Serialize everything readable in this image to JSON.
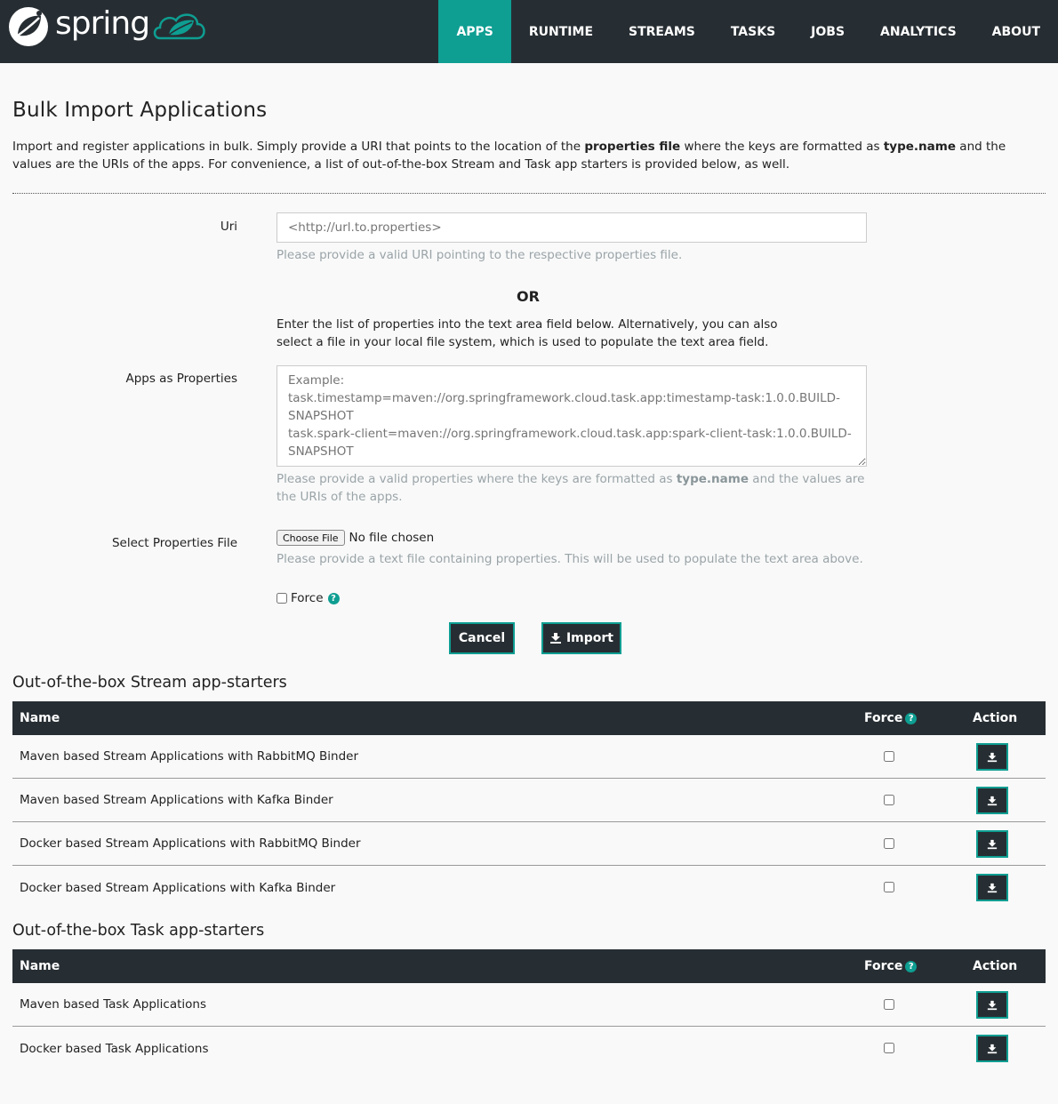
{
  "brand": {
    "name": "spring"
  },
  "nav": {
    "items": [
      {
        "label": "APPS",
        "active": true
      },
      {
        "label": "RUNTIME",
        "active": false
      },
      {
        "label": "STREAMS",
        "active": false
      },
      {
        "label": "TASKS",
        "active": false
      },
      {
        "label": "JOBS",
        "active": false
      },
      {
        "label": "ANALYTICS",
        "active": false
      },
      {
        "label": "ABOUT",
        "active": false
      }
    ]
  },
  "page": {
    "title": "Bulk Import Applications",
    "intro_1": "Import and register applications in bulk. Simply provide a URI that points to the location of the ",
    "intro_bold_1": "properties file",
    "intro_2": " where the keys are formatted as ",
    "intro_bold_2": "type.name",
    "intro_3": " and the values are the URIs of the apps. For convenience, a list of out-of-the-box Stream and Task app starters is provided below, as well."
  },
  "form": {
    "uri_label": "Uri",
    "uri_placeholder": "<http://url.to.properties>",
    "uri_help": "Please provide a valid URI pointing to the respective properties file.",
    "or_label": "OR",
    "or_text": "Enter the list of properties into the text area field below. Alternatively, you can also select a file in your local file system, which is used to populate the text area field.",
    "props_label": "Apps as Properties",
    "props_placeholder": "Example:\ntask.timestamp=maven://org.springframework.cloud.task.app:timestamp-task:1.0.0.BUILD-SNAPSHOT\ntask.spark-client=maven://org.springframework.cloud.task.app:spark-client-task:1.0.0.BUILD-SNAPSHOT",
    "props_help_1": "Please provide a valid properties where the keys are formatted as ",
    "props_help_bold": "type.name",
    "props_help_2": " and the values are the URIs of the apps.",
    "file_label": "Select Properties File",
    "choose_file": "Choose File",
    "file_status": "No file chosen",
    "file_help": "Please provide a text file containing properties. This will be used to populate the text area above.",
    "force_label": "Force",
    "cancel_label": "Cancel",
    "import_label": "Import"
  },
  "stream_starters": {
    "title": "Out-of-the-box Stream app-starters",
    "col_name": "Name",
    "col_force": "Force",
    "col_action": "Action",
    "rows": [
      {
        "name": "Maven based Stream Applications with RabbitMQ Binder"
      },
      {
        "name": "Maven based Stream Applications with Kafka Binder"
      },
      {
        "name": "Docker based Stream Applications with RabbitMQ Binder"
      },
      {
        "name": "Docker based Stream Applications with Kafka Binder"
      }
    ]
  },
  "task_starters": {
    "title": "Out-of-the-box Task app-starters",
    "col_name": "Name",
    "col_force": "Force",
    "col_action": "Action",
    "rows": [
      {
        "name": "Maven based Task Applications"
      },
      {
        "name": "Docker based Task Applications"
      }
    ]
  },
  "colors": {
    "accent": "#0e9e92",
    "header": "#272e33",
    "background": "#f9f9f9"
  },
  "icons": {
    "help": "question-circle-icon",
    "import": "import-icon"
  }
}
